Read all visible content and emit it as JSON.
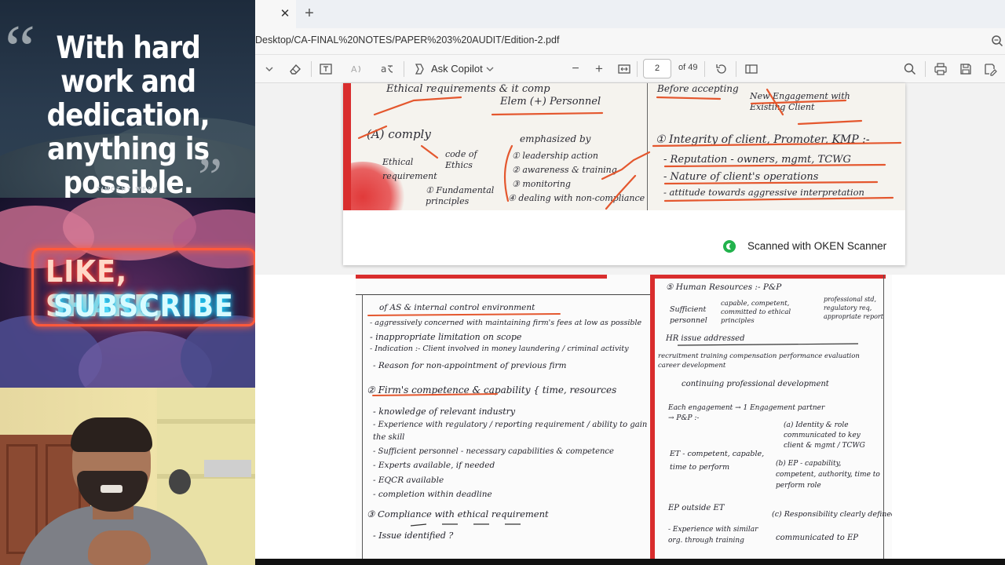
{
  "overlay": {
    "quote": {
      "open_mark": "“",
      "close_mark": "”",
      "text": "With hard work and dedication, anything is possible.",
      "author": "TIMOTHY WEAH"
    },
    "promo": {
      "line1": "LIKE, SHARE,",
      "line2": "SUBSCRIBE"
    }
  },
  "browser": {
    "tab_close_glyph": "✕",
    "new_tab_glyph": "+",
    "url": "Desktop/CA-FINAL%20NOTES/PAPER%203%20AUDIT/Edition-2.pdf"
  },
  "pdf_toolbar": {
    "copilot_label": "Ask Copilot",
    "zoom_out_glyph": "−",
    "zoom_in_glyph": "+",
    "current_page": "2",
    "total_pages": "of 49"
  },
  "page1": {
    "scanner_credit": "Scanned with OKEN Scanner",
    "notes": [
      "Ethical requirements & it comp",
      "Elem (+) Personnel",
      "(A) comply",
      "Ethical requirement",
      "code of Ethics",
      "① Fundamental principles",
      "emphasized by",
      "① leadership action",
      "② awareness & training",
      "③ monitoring",
      "④ dealing with non-compliance",
      "Before accepting",
      "New Engagement with Existing Client",
      "① Integrity of client, Promoter, KMP :-",
      "- Reputation - owners, mgmt, TCWG",
      "- Nature of client's operations",
      "- attitude towards aggressive interpretation"
    ]
  },
  "page2": {
    "left_notes": [
      "of AS & internal control environment",
      "- aggressively concerned with maintaining firm's fees at low as possible",
      "- inappropriate limitation on scope",
      "- Indication :- Client involved in money laundering / criminal activity",
      "- Reason for non-appointment of previous firm",
      "② Firm's competence & capability { time, resources",
      "- knowledge of relevant industry",
      "- Experience with regulatory / reporting requirement / ability to gain the skill",
      "- Sufficient personnel - necessary capabilities & competence",
      "- Experts available, if needed",
      "- EQCR available",
      "- completion within deadline",
      "③ Compliance with ethical requirement",
      "- Issue identified ?"
    ],
    "right_notes": [
      "⑤ Human Resources :- P&P",
      "Sufficient personnel",
      "capable, competent, committed to ethical principles",
      "professional std, regulatory req, appropriate report",
      "HR issue addressed",
      "recruitment  training  compensation  performance evaluation  career development",
      "continuing professional development",
      "Each engagement → 1 Engagement partner → P&P :-",
      "(a) Identity & role communicated to key client & mgmt / TCWG",
      "ET - competent, capable, time to perform",
      "(b) EP - capability, competent, authority, time to perform role",
      "EP outside ET",
      "- Experience with similar org. through training",
      "(c) Responsibility clearly defined",
      "communicated to EP"
    ]
  }
}
